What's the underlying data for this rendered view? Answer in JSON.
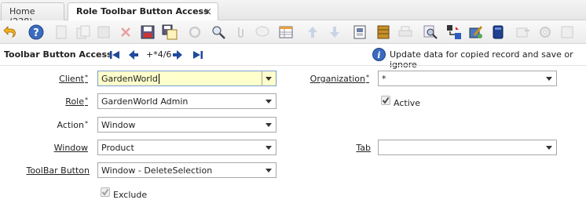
{
  "tabs": [
    {
      "label": "Home (238)"
    },
    {
      "label": "Role Toolbar Button Access",
      "close": "×"
    }
  ],
  "toolbar": {
    "icons": [
      "undo-icon",
      "help-icon",
      "new-icon",
      "copy-icon",
      "delete-icon",
      "save-icon",
      "save-new-icon",
      "refresh-icon",
      "find-icon",
      "attachment-icon",
      "chat-icon",
      "grid-toggle-icon",
      "parent-record-icon",
      "detail-record-icon",
      "report-icon",
      "archive-icon",
      "print-icon",
      "zoom-across-icon",
      "workflow-icon",
      "product-info-icon",
      "window-customize-icon",
      "process-icon",
      "end-window-icon"
    ]
  },
  "record": {
    "title": "Toolbar Button Access",
    "count": "+*4/6",
    "info": "Update data for copied record and save or ignore"
  },
  "form": {
    "client_label": "Client",
    "client_value": "GardenWorld",
    "organization_label": "Organization",
    "organization_value": "*",
    "role_label": "Role",
    "role_value": "GardenWorld Admin",
    "active_label": "Active",
    "action_label": "Action",
    "action_value": "Window",
    "window_label": "Window",
    "window_value": "Product",
    "tab_label": "Tab",
    "tab_value": "",
    "toolbar_button_label": "ToolBar Button",
    "toolbar_button_value": "Window - DeleteSelection",
    "exclude_label": "Exclude",
    "required_mark": "*"
  }
}
